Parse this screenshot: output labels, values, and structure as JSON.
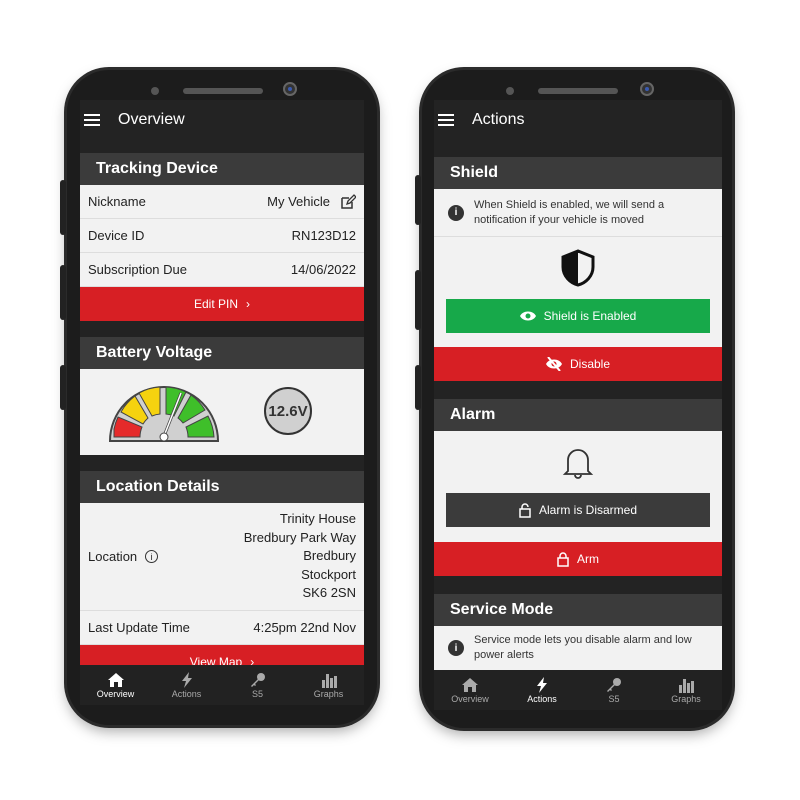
{
  "overview": {
    "title": "Overview",
    "tracking": {
      "title": "Tracking Device",
      "rows": [
        {
          "label": "Nickname",
          "value": "My Vehicle"
        },
        {
          "label": "Device ID",
          "value": "RN123D12"
        },
        {
          "label": "Subscription Due",
          "value": "14/06/2022"
        }
      ],
      "edit_pin": "Edit PIN"
    },
    "battery": {
      "title": "Battery Voltage",
      "voltage": "12.6V",
      "gauge_level": 0.7
    },
    "location": {
      "title": "Location Details",
      "label": "Location",
      "address": [
        "Trinity House",
        "Bredbury Park Way",
        "Bredbury",
        "Stockport",
        "SK6 2SN"
      ],
      "update_label": "Last Update Time",
      "update_value": "4:25pm 22nd Nov",
      "view_map": "View Map"
    }
  },
  "actions": {
    "title": "Actions",
    "shield": {
      "title": "Shield",
      "info": "When Shield is enabled, we will send a notification if your vehicle is moved",
      "status": "Shield is Enabled",
      "disable": "Disable"
    },
    "alarm": {
      "title": "Alarm",
      "status": "Alarm is Disarmed",
      "arm": "Arm"
    },
    "service": {
      "title": "Service Mode",
      "info": "Service mode lets you disable alarm and low power alerts"
    }
  },
  "nav": [
    {
      "label": "Overview",
      "icon": "home-icon"
    },
    {
      "label": "Actions",
      "icon": "bolt-icon"
    },
    {
      "label": "S5",
      "icon": "key-icon"
    },
    {
      "label": "Graphs",
      "icon": "bar-chart-icon"
    }
  ],
  "colors": {
    "red": "#d71f24",
    "green": "#17a94a",
    "dark": "#3b3b3b"
  }
}
